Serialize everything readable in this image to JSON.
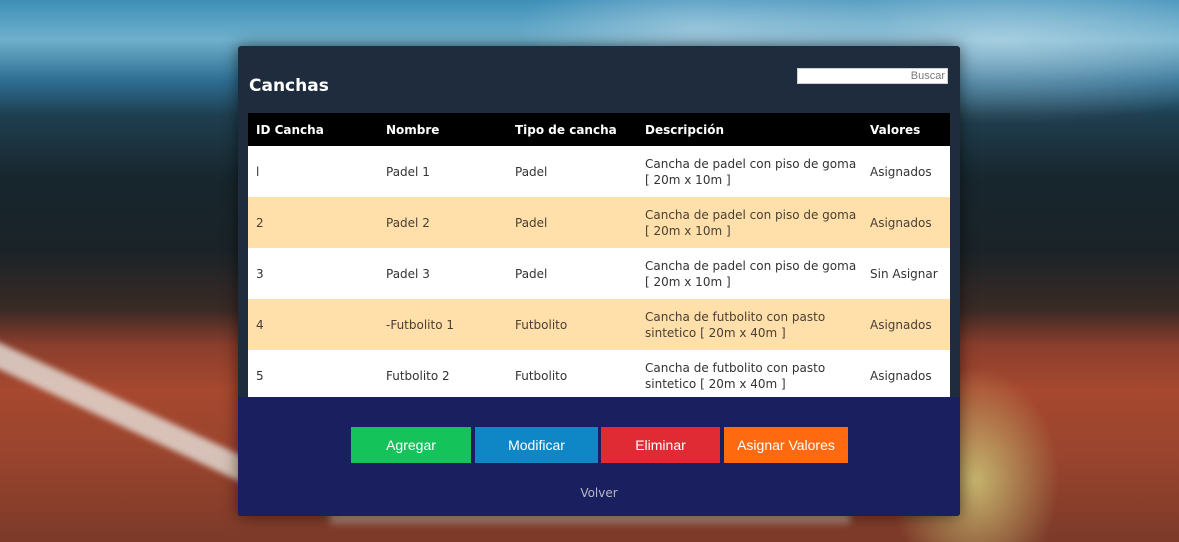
{
  "panel": {
    "title": "Canchas",
    "search_placeholder": "Buscar"
  },
  "table": {
    "headers": [
      "ID Cancha",
      "Nombre",
      "Tipo de cancha",
      "Descripción",
      "Valores"
    ],
    "rows": [
      {
        "id": "l",
        "nombre": "Padel 1",
        "tipo": "Padel",
        "descripcion": "Cancha de padel con piso de goma [ 20m x 10m ]",
        "valores": "Asignados"
      },
      {
        "id": "2",
        "nombre": "Padel 2",
        "tipo": "Padel",
        "descripcion": "Cancha de padel con piso de goma [ 20m x 10m ]",
        "valores": "Asignados"
      },
      {
        "id": "3",
        "nombre": "Padel 3",
        "tipo": "Padel",
        "descripcion": "Cancha de padel con piso de goma [ 20m x 10m ]",
        "valores": "Sin Asignar"
      },
      {
        "id": "4",
        "nombre": "-Futbolito 1",
        "tipo": "Futbolito",
        "descripcion": "Cancha de futbolito con pasto sintetico [ 20m x 40m ]",
        "valores": "Asignados"
      },
      {
        "id": "5",
        "nombre": "Futbolito 2",
        "tipo": "Futbolito",
        "descripcion": "Cancha de futbolito con pasto sintetico [ 20m x 40m ]",
        "valores": "Asignados"
      }
    ]
  },
  "actions": {
    "agregar": "Agregar",
    "modificar": "Modificar",
    "eliminar": "Eliminar",
    "asignar": "Asignar Valores",
    "volver": "Volver"
  },
  "colors": {
    "panel": "#1f2c3e",
    "footer": "#1a1f5f",
    "row_alt": "#ffdfaa",
    "agregar": "#14c35a",
    "modificar": "#0f86c6",
    "eliminar": "#e02a34",
    "asignar": "#ff6a10"
  }
}
